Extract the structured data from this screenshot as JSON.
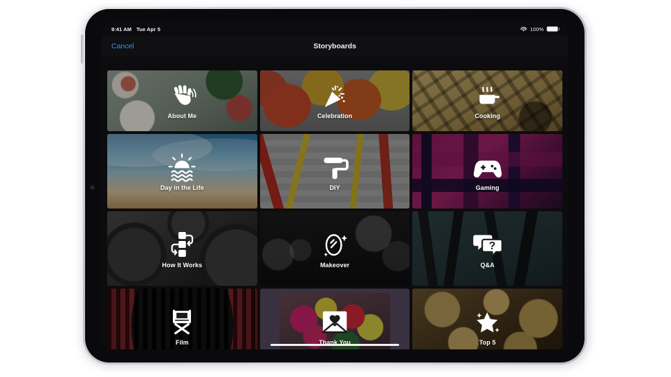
{
  "status_bar": {
    "time": "9:41 AM",
    "date": "Tue Apr 5",
    "battery_percent": "100%",
    "wifi_icon": "wifi-icon",
    "battery_icon": "battery-icon"
  },
  "nav": {
    "cancel_label": "Cancel",
    "title": "Storyboards"
  },
  "colors": {
    "accent": "#3b93f5",
    "screen_background": "#0c0c0e",
    "nav_background": "#101012",
    "label_text": "#ffffff",
    "selected_card_background": "#3a3140"
  },
  "grid": {
    "columns": 3,
    "cards": [
      {
        "label": "About Me",
        "icon": "waving-hand-icon",
        "bg": "bg-aboutme",
        "selected": false,
        "first_row": true
      },
      {
        "label": "Celebration",
        "icon": "party-popper-icon",
        "bg": "bg-celebration",
        "selected": false,
        "first_row": true
      },
      {
        "label": "Cooking",
        "icon": "steaming-pot-icon",
        "bg": "bg-cooking",
        "selected": false,
        "first_row": true
      },
      {
        "label": "Day in the Life",
        "icon": "sunrise-water-icon",
        "bg": "bg-dayinlife",
        "selected": false,
        "first_row": false
      },
      {
        "label": "DIY",
        "icon": "paint-roller-icon",
        "bg": "bg-diy",
        "selected": false,
        "first_row": false
      },
      {
        "label": "Gaming",
        "icon": "gamepad-icon",
        "bg": "bg-gaming",
        "selected": false,
        "first_row": false
      },
      {
        "label": "How It Works",
        "icon": "flowchart-steps-icon",
        "bg": "bg-howitworks",
        "selected": false,
        "first_row": false
      },
      {
        "label": "Makeover",
        "icon": "sparkle-mirror-icon",
        "bg": "bg-makeover",
        "selected": false,
        "first_row": false
      },
      {
        "label": "Q&A",
        "icon": "question-bubble-icon",
        "bg": "bg-qa",
        "selected": false,
        "first_row": false
      },
      {
        "label": "Film",
        "icon": "director-chair-icon",
        "bg": "bg-film",
        "selected": false,
        "first_row": false
      },
      {
        "label": "Thank You",
        "icon": "heart-envelope-icon",
        "bg": "bg-thankyou",
        "selected": true,
        "first_row": false
      },
      {
        "label": "Top 5",
        "icon": "star-sparkle-icon",
        "bg": "bg-top5",
        "selected": false,
        "first_row": false
      }
    ]
  },
  "device": {
    "home_indicator": "home-indicator",
    "front_camera": "front-camera-icon",
    "side_button": "volume-button"
  }
}
